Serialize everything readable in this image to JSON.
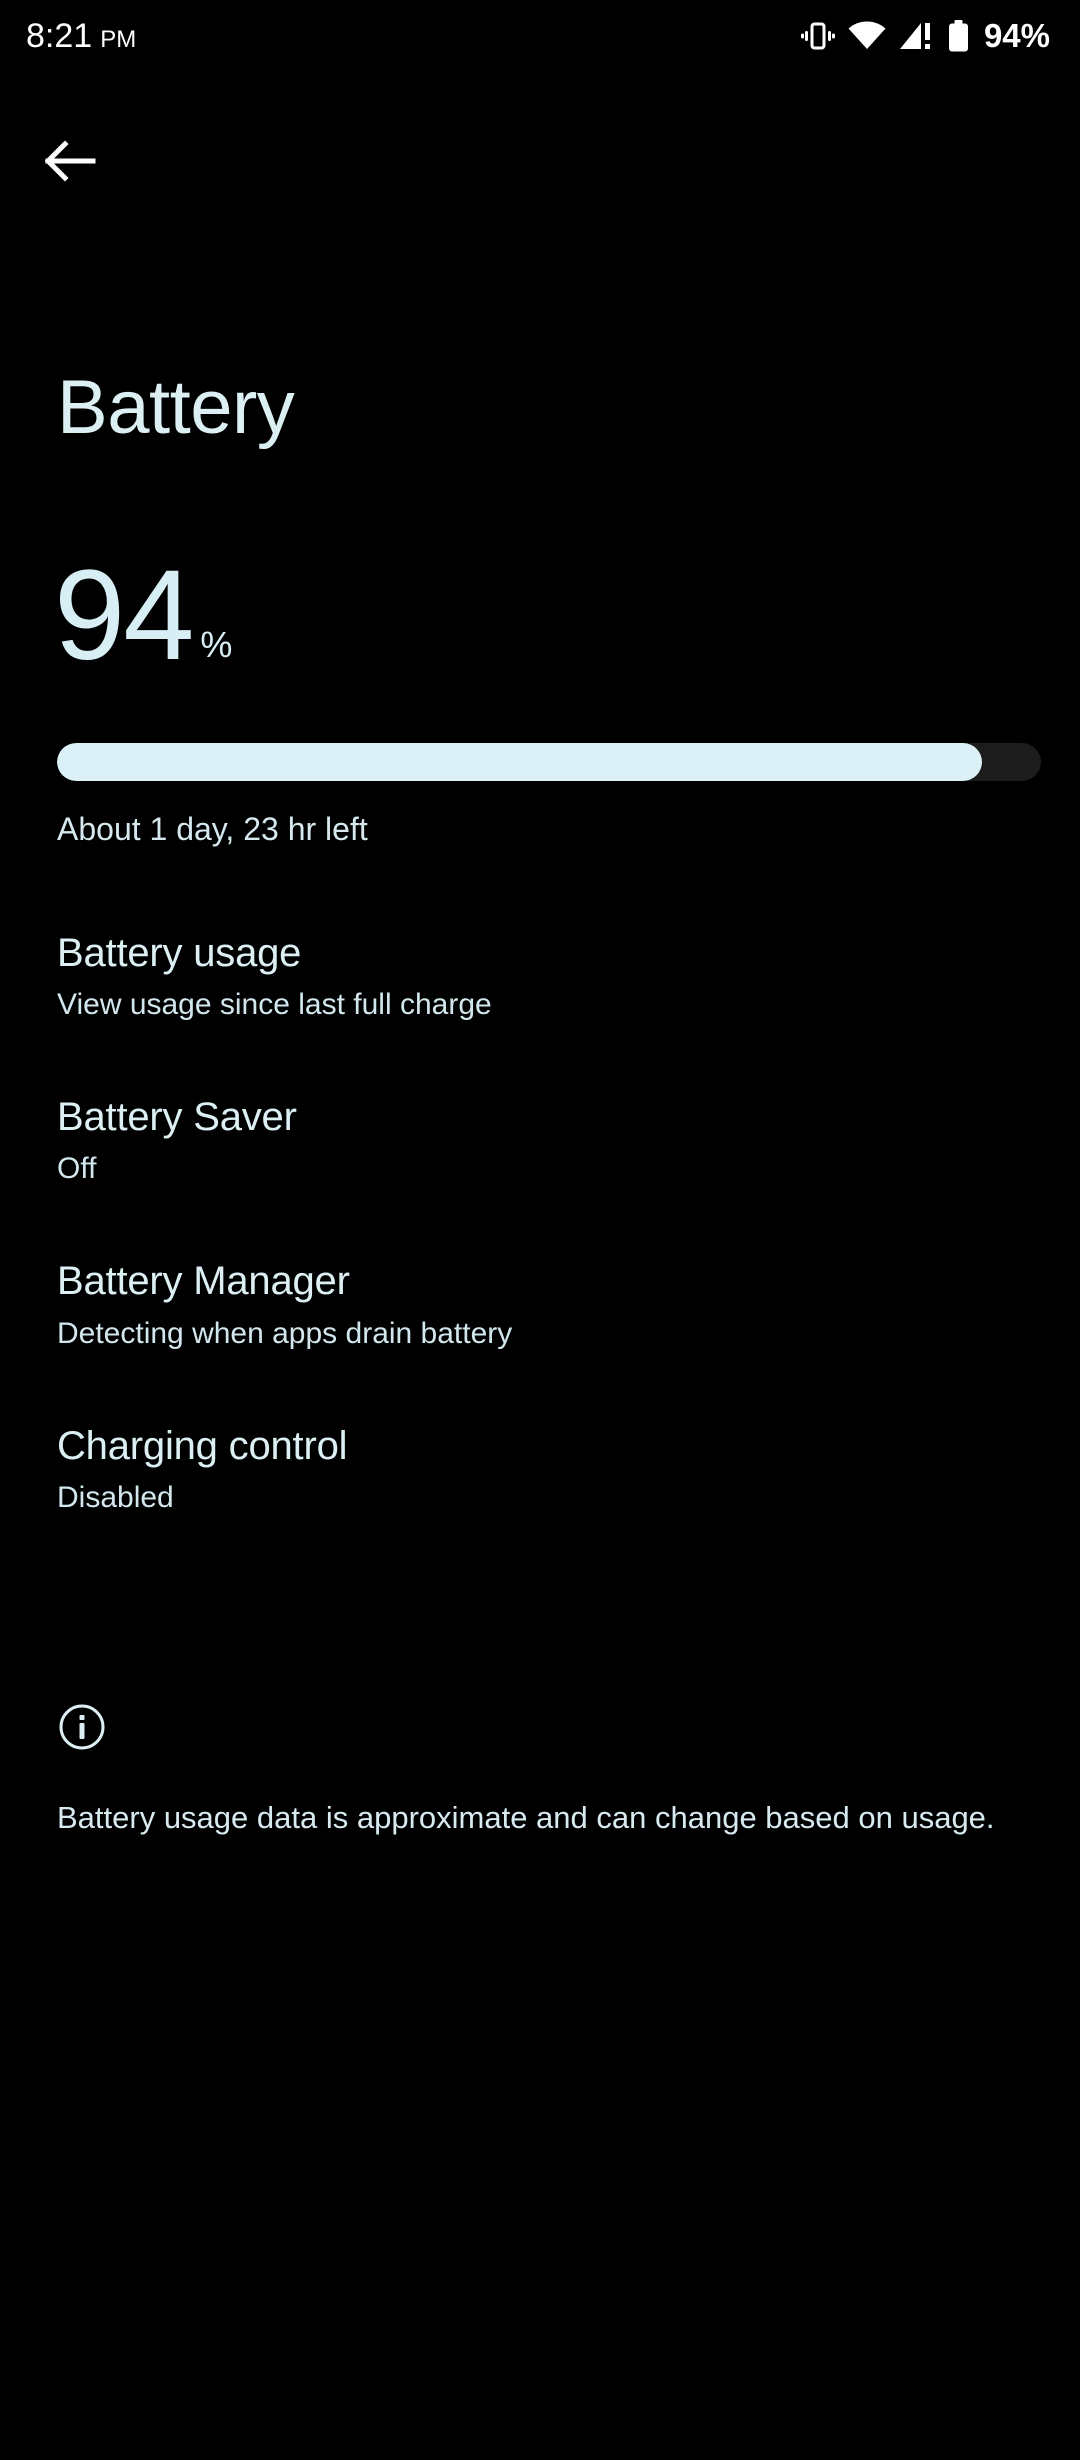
{
  "status_bar": {
    "time": "8:21",
    "ampm": "PM",
    "battery_percent_label": "94%",
    "icons": {
      "vibrate": "vibrate-icon",
      "wifi": "wifi-icon",
      "cellular": "cellular-signal-alert-icon",
      "battery": "battery-icon"
    }
  },
  "nav": {
    "back": "back-arrow-icon"
  },
  "header": {
    "title": "Battery"
  },
  "battery": {
    "level_number": "94",
    "percent_sign": "%",
    "level_value": 94,
    "time_remaining": "About 1 day, 23 hr left",
    "fill_color": "#dcf1f7",
    "track_color": "#1c1c1c"
  },
  "preferences": [
    {
      "title": "Battery usage",
      "subtitle": "View usage since last full charge"
    },
    {
      "title": "Battery Saver",
      "subtitle": "Off"
    },
    {
      "title": "Battery Manager",
      "subtitle": "Detecting when apps drain battery"
    },
    {
      "title": "Charging control",
      "subtitle": "Disabled"
    }
  ],
  "footer": {
    "icon": "info-icon",
    "text": "Battery usage data is approximate and can change based on usage."
  },
  "theme": {
    "background": "#000000",
    "accent_text": "#dcf0f4",
    "secondary_text": "#d2e7ed"
  }
}
